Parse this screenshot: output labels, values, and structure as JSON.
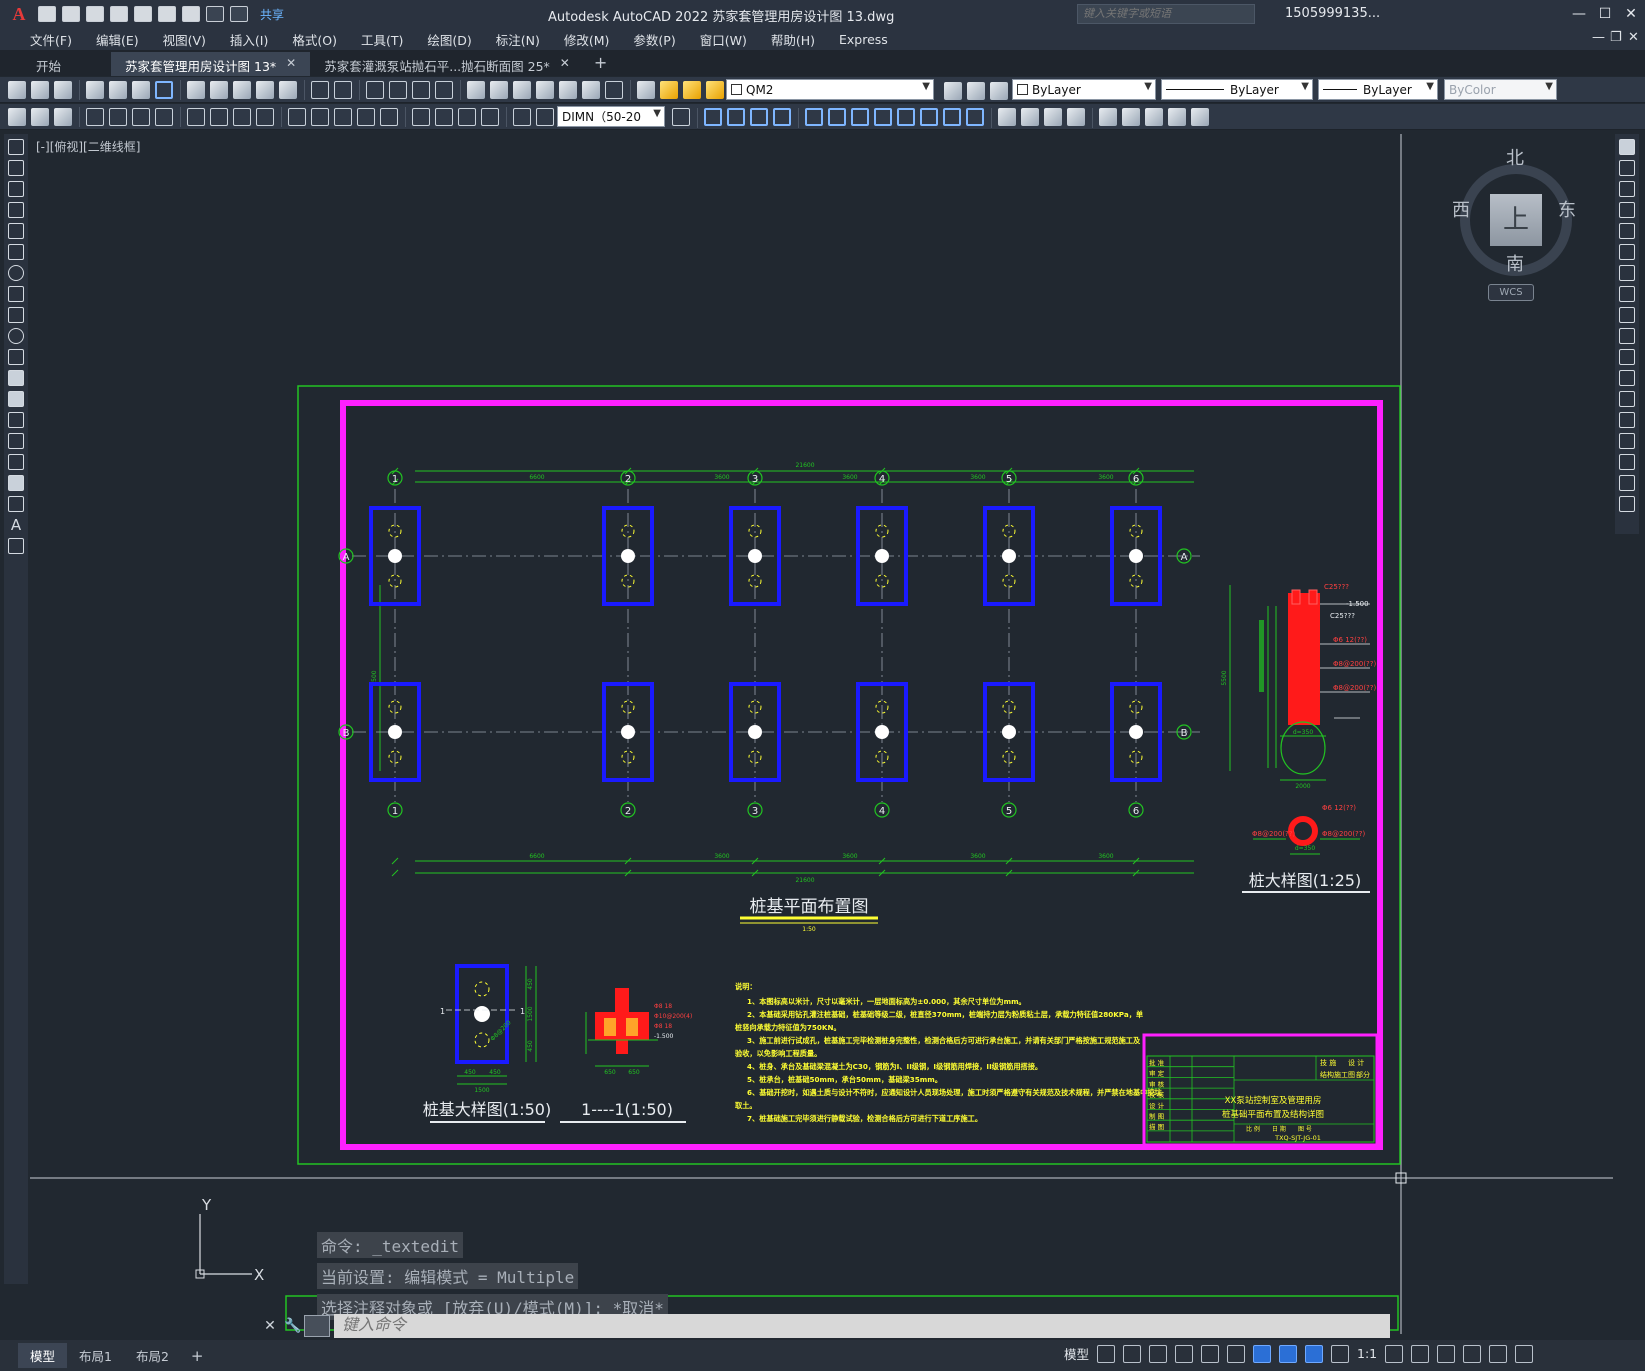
{
  "app": {
    "logo": "A",
    "title": "Autodesk AutoCAD 2022    苏家套管理用房设计图 13.dwg",
    "share_label": "共享",
    "search_placeholder": "键入关键字或短语",
    "user": "1505999135...",
    "window_controls": {
      "minimize": "—",
      "maximize": "☐",
      "close": "✕"
    }
  },
  "menu": {
    "items": [
      "文件(F)",
      "编辑(E)",
      "视图(V)",
      "插入(I)",
      "格式(O)",
      "工具(T)",
      "绘图(D)",
      "标注(N)",
      "修改(M)",
      "参数(P)",
      "窗口(W)",
      "帮助(H)",
      "Express"
    ]
  },
  "tabs": [
    {
      "label": "开始",
      "closable": false
    },
    {
      "label": "苏家套管理用房设计图 13*",
      "closable": true,
      "active": true
    },
    {
      "label": "苏家套灌溉泵站抛石平...抛石断面图 25*",
      "closable": true
    }
  ],
  "toolbar": {
    "layer_name": "QM2",
    "color": "ByLayer",
    "linetype": "ByLayer",
    "lineweight": "ByLayer",
    "plotstyle": "ByColor",
    "dimstyle": "DIMN（50-20"
  },
  "viewport": {
    "label": "[-][俯视][二维线框]",
    "viewcube": {
      "face": "上",
      "north": "北",
      "south": "南",
      "east": "东",
      "west": "西",
      "wcs": "WCS"
    },
    "ucs": {
      "x": "X",
      "y": "Y"
    }
  },
  "drawing": {
    "plan_title": "桩基平面布置图",
    "plan_scale": "1:50",
    "axes_numbers": [
      "1",
      "2",
      "3",
      "4",
      "5",
      "6"
    ],
    "axes_letters": [
      "A",
      "B"
    ],
    "dim_total_top": "21600",
    "dim_total_bottom": "21600",
    "dim_segments": [
      "6600",
      "3600",
      "3600",
      "3600",
      "3600"
    ],
    "dim_side": "5500",
    "detail_pile_title": "桩大样图(1:25)",
    "detail_base_title": "桩基大样图(1:50)",
    "section_title": "1----1(1:50)",
    "section_mark": "1",
    "pile_notes": {
      "top": "-1.500",
      "r1": "C25???",
      "r2": "Φ6 12(??)",
      "r3": "Φ8@200(??)",
      "r4": "Φ8@200(??)",
      "bottom": "d=350",
      "base": "2000",
      "circ_left": "Φ8@200(??)",
      "circ_right": "Φ8@200(??)",
      "circ_top": "Φ6 12(??)",
      "circ_dim": "d=350"
    },
    "base_notes": {
      "w1": "450",
      "w2": "450",
      "w": "1500",
      "h1": "450",
      "h2": "1500",
      "h3": "450",
      "rebar": "Φ8@200",
      "section_top": "-1.500",
      "section_r1": "Φ8 18",
      "section_r2": "Φ10@200(4)",
      "section_w1": "650",
      "section_w2": "650"
    },
    "notes_title": "说明：",
    "notes": [
      "1、本图标高以米计，尺寸以毫米计，一层地面标高为±0.000，其余尺寸单位为mm。",
      "2、本基础采用钻孔灌注桩基础，桩基础等级二级，桩直径370mm，桩端持力层为粉质粘土层，承载力特征值280KPa，单",
      "桩竖向承载力特征值为750KN。",
      "3、施工前进行试成孔，桩基施工完毕检测桩身完整性，检测合格后方可进行承台施工，并请有关部门严格按施工规范施工及",
      "验收，以免影响工程质量。",
      "4、桩身、承台及基础梁混凝土为C30，钢筋为I、II级钢，I级钢筋用焊接，II级钢筋用搭接。",
      "5、桩承台，桩基础50mm，承台50mm，基础梁35mm。",
      "6、基础开挖时，如遇土质与设计不符时，应通知设计人员现场处理，施工时须严格遵守有关规范及技术规程，并严禁在地基中挖坑",
      "取土。",
      "7、桩基础施工完毕须进行静载试验，检测合格后方可进行下道工序施工。"
    ],
    "titleblock": {
      "project": "XX泵站控制室及管理用房",
      "drawing": "桩基础平面布置及结构详图",
      "number": "TXQ-SJT-JG-01",
      "rows": [
        "批 准",
        "审 定",
        "审 核",
        "校 核",
        "设 计",
        "制 图",
        "描 图"
      ],
      "top_right": [
        "技 施",
        "设 计"
      ],
      "top_right2": [
        "结构施工图",
        "部分"
      ],
      "bottom": [
        "比 例",
        "日 期",
        "图 号"
      ]
    }
  },
  "command": {
    "history": [
      "命令: _textedit",
      "当前设置: 编辑模式 = Multiple",
      "选择注释对象或 [放弃(U)/模式(M)]: *取消*"
    ],
    "placeholder": "键入命令"
  },
  "status": {
    "layouts": [
      "模型",
      "布局1",
      "布局2"
    ],
    "model_label": "模型",
    "scale_label": "1:1"
  }
}
